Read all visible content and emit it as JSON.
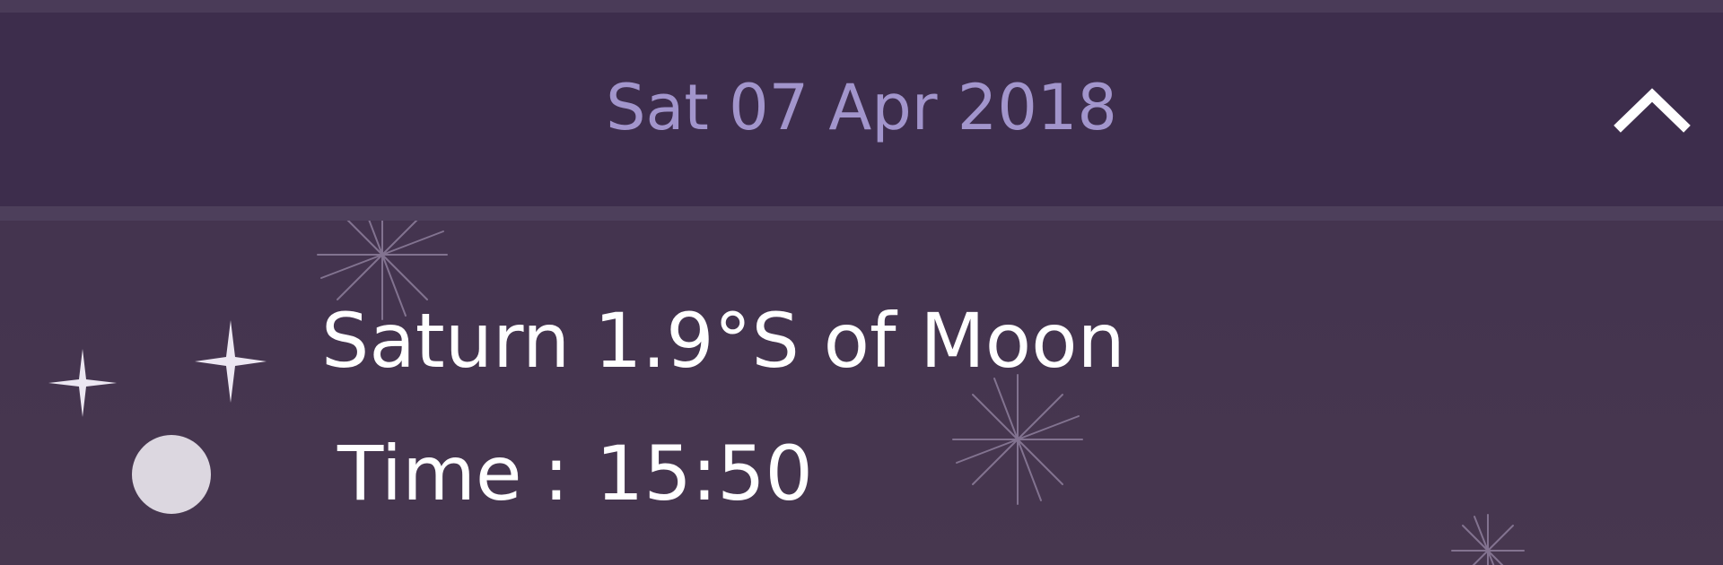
{
  "header": {
    "date": "Sat 07 Apr 2018",
    "collapse_icon": "chevron-up-icon"
  },
  "event": {
    "title": "Saturn 1.9°S of Moon",
    "time_label": "Time",
    "time_separator": ":",
    "time_value": "15:50",
    "planet_icon": "four-point-star-icon",
    "moon_icon": "moon-icon"
  },
  "colors": {
    "background": "#453552",
    "header_background": "#3d2d4c",
    "date_text": "#a295cc",
    "event_text": "#ffffff",
    "moon": "#dcd7e0"
  }
}
